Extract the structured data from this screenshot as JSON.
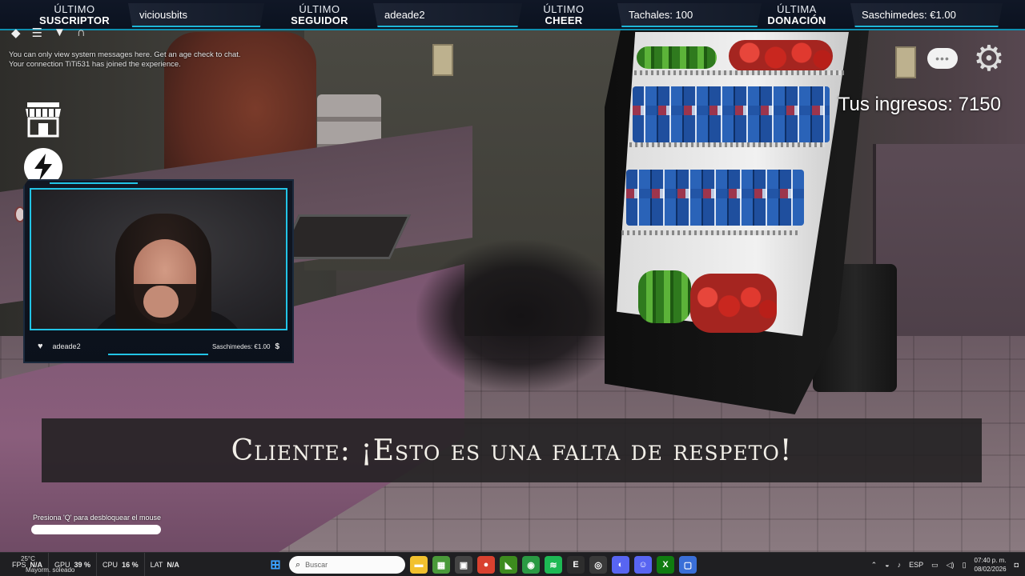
{
  "topbar": {
    "segments": [
      {
        "line1": "ÚLTIMO",
        "line2": "SUSCRIPTOR",
        "value": "viciousbits"
      },
      {
        "line1": "ÚLTIMO",
        "line2": "SEGUIDOR",
        "value": "adeade2"
      },
      {
        "line1": "ÚLTIMO",
        "line2": "CHEER",
        "value": "Tachales: 100"
      },
      {
        "line1": "ÚLTIMA",
        "line2": "DONACIÓN",
        "value": "Saschimedes: €1.00"
      }
    ]
  },
  "chat": {
    "messages": [
      "You can only view system messages here. Get an age check to chat.",
      "Your connection TiTi531 has joined the experience."
    ]
  },
  "webcam": {
    "follower_name": "adeade2",
    "donation": "Saschimedes: €1.00",
    "dollar_symbol": "$"
  },
  "hud": {
    "income": "Tus ingresos: 7150"
  },
  "subtitle": {
    "text": "Cliente: ¡Esto es una falta de respeto!"
  },
  "hint": {
    "text": "Presiona 'Q' para desbloquear el mouse"
  },
  "taskbar": {
    "weather_temp": "25°C",
    "weather_desc": "Mayorm. soleado",
    "fps_label": "FPS",
    "fps_value": "N/A",
    "gpu_label": "GPU",
    "gpu_value": "39 %",
    "cpu_label": "CPU",
    "cpu_value": "16 %",
    "lat_label": "LAT",
    "lat_value": "N/A",
    "search_placeholder": "Buscar",
    "language": "ESP",
    "time": "07:40 p. m.",
    "date": "08/02/2026",
    "apps": [
      {
        "name": "file-explorer",
        "color": "#f2c12e",
        "glyph": "▬"
      },
      {
        "name": "minecraft",
        "color": "#4a9a3a",
        "glyph": "▦"
      },
      {
        "name": "ms-store",
        "color": "#444",
        "glyph": "▣"
      },
      {
        "name": "chrome",
        "color": "#d9412f",
        "glyph": "●"
      },
      {
        "name": "nvidia",
        "color": "#3d8b1e",
        "glyph": "◣"
      },
      {
        "name": "spotify-like",
        "color": "#2a9a43",
        "glyph": "◉"
      },
      {
        "name": "spotify",
        "color": "#1db954",
        "glyph": "≋"
      },
      {
        "name": "epic",
        "color": "#2d2d2d",
        "glyph": "E"
      },
      {
        "name": "obs",
        "color": "#3a3a3a",
        "glyph": "◎"
      },
      {
        "name": "discord-like",
        "color": "#5865f2",
        "glyph": "◐"
      },
      {
        "name": "discord",
        "color": "#5865f2",
        "glyph": "☺"
      },
      {
        "name": "xbox",
        "color": "#107c10",
        "glyph": "X"
      },
      {
        "name": "roblox",
        "color": "#3a6fd8",
        "glyph": "▢"
      }
    ]
  }
}
